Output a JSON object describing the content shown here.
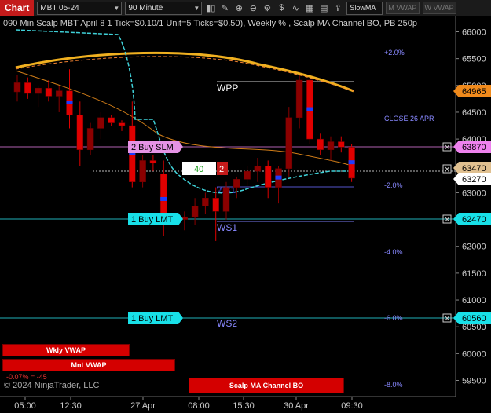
{
  "toolbar": {
    "chart_tab": "Chart",
    "instrument": "MBT 05-24",
    "interval": "90 Minute",
    "indicator_select": "SlowMA",
    "btn_m_vwap": "M VWAP",
    "btn_w_vwap": "W VWAP"
  },
  "title": "090 Min Scalp MBT April 8 1 Tick=$0.10/1 Unit=5 Ticks=$0.50), Weekly % , Scalp MA Channel BO, PB 250p",
  "price_axis": {
    "ticks": [
      "66000",
      "65500",
      "65000",
      "64500",
      "64000",
      "63500",
      "63000",
      "62500",
      "62000",
      "61500",
      "61000",
      "60500",
      "60000",
      "59500"
    ],
    "labels": {
      "level_orange": "64965",
      "order_2_buy_slm": "63870",
      "last_tan": "63470",
      "current_white": "63270",
      "order_1_buy_lmt": "62470",
      "order_1_buy_lmt_2": "60560"
    }
  },
  "time_axis": [
    "05:00",
    "12:30",
    "27 Apr",
    "08:00",
    "15:30",
    "30 Apr",
    "09:30"
  ],
  "annotations": {
    "pct_plus2": "+2.0%",
    "close_label": "CLOSE 26 APR",
    "pct_minus2": "-2.0%",
    "pct_minus4": "-4.0%",
    "pct_minus6": "-6.0%",
    "pct_minus8": "-8.0%",
    "wpp": "WPP",
    "ws1": "WS1",
    "ws2": "WS2",
    "ws_small": "WS1"
  },
  "orders": {
    "buy_slm": "2 Buy SLM",
    "buy_lmt_1": "1 Buy LMT",
    "buy_lmt_2": "1 Buy LMT",
    "position_qty": "40",
    "position_count": "2"
  },
  "bottom_bars": {
    "wkly_vwap": "Wkly VWAP",
    "mnt_vwap": "Mnt VWAP",
    "pnl_text": "-0.07% = -45",
    "scalp_bo": "Scalp MA Channel BO"
  },
  "copyright": "© 2024 NinjaTrader, LLC",
  "colors": {
    "up_candle": "#8b0000",
    "down_candle": "#e00000",
    "fast_ma": "#3fd1d8",
    "slow_ma": "#f0a020",
    "orange_ma": "#e08a1c",
    "order_magenta": "#ee82ee",
    "order_cyan": "#00e5ee"
  },
  "chart_data": {
    "type": "candlestick",
    "y_range": [
      59200,
      66300
    ],
    "candles": [
      {
        "o": 64880,
        "h": 65200,
        "l": 64700,
        "c": 65050
      },
      {
        "o": 65050,
        "h": 65150,
        "l": 64750,
        "c": 64850
      },
      {
        "o": 64850,
        "h": 65000,
        "l": 64600,
        "c": 64950
      },
      {
        "o": 64950,
        "h": 65100,
        "l": 64700,
        "c": 64800
      },
      {
        "o": 64800,
        "h": 65000,
        "l": 64500,
        "c": 64900
      },
      {
        "o": 64900,
        "h": 65300,
        "l": 64200,
        "c": 64450
      },
      {
        "o": 64450,
        "h": 64700,
        "l": 63500,
        "c": 63800
      },
      {
        "o": 63800,
        "h": 64300,
        "l": 63700,
        "c": 64200
      },
      {
        "o": 64200,
        "h": 64500,
        "l": 64000,
        "c": 64400
      },
      {
        "o": 64400,
        "h": 64450,
        "l": 64250,
        "c": 64300
      },
      {
        "o": 64300,
        "h": 64350,
        "l": 64150,
        "c": 64250
      },
      {
        "o": 64250,
        "h": 64700,
        "l": 63100,
        "c": 63200
      },
      {
        "o": 63200,
        "h": 63700,
        "l": 63100,
        "c": 63600
      },
      {
        "o": 63600,
        "h": 63700,
        "l": 63400,
        "c": 63550
      },
      {
        "o": 63350,
        "h": 63600,
        "l": 62200,
        "c": 62400
      },
      {
        "o": 62400,
        "h": 62600,
        "l": 62100,
        "c": 62500
      },
      {
        "o": 62500,
        "h": 62650,
        "l": 62300,
        "c": 62550
      },
      {
        "o": 62550,
        "h": 62900,
        "l": 62400,
        "c": 62750
      },
      {
        "o": 62750,
        "h": 63000,
        "l": 62600,
        "c": 62900
      },
      {
        "o": 62900,
        "h": 63100,
        "l": 62100,
        "c": 62650
      },
      {
        "o": 62650,
        "h": 63200,
        "l": 62500,
        "c": 63100
      },
      {
        "o": 63100,
        "h": 63300,
        "l": 62900,
        "c": 63250
      },
      {
        "o": 63250,
        "h": 63500,
        "l": 63100,
        "c": 63400
      },
      {
        "o": 63400,
        "h": 63650,
        "l": 63200,
        "c": 63500
      },
      {
        "o": 63500,
        "h": 63600,
        "l": 62900,
        "c": 63100
      },
      {
        "o": 63100,
        "h": 63500,
        "l": 62800,
        "c": 63450
      },
      {
        "o": 63450,
        "h": 64600,
        "l": 63300,
        "c": 64400
      },
      {
        "o": 64400,
        "h": 65200,
        "l": 64200,
        "c": 65100
      },
      {
        "o": 65100,
        "h": 65150,
        "l": 63900,
        "c": 64000
      },
      {
        "o": 64000,
        "h": 64100,
        "l": 63700,
        "c": 63800
      },
      {
        "o": 63800,
        "h": 64050,
        "l": 63600,
        "c": 63950
      },
      {
        "o": 63950,
        "h": 64050,
        "l": 63750,
        "c": 63850
      },
      {
        "o": 63850,
        "h": 63900,
        "l": 63200,
        "c": 63270
      }
    ]
  }
}
